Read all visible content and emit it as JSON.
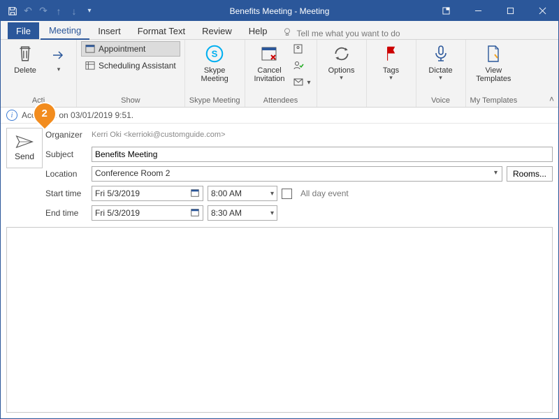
{
  "window": {
    "title": "Benefits Meeting - Meeting"
  },
  "tabs": {
    "file": "File",
    "meeting": "Meeting",
    "insert": "Insert",
    "format_text": "Format Text",
    "review": "Review",
    "help": "Help",
    "tell_me": "Tell me what you want to do"
  },
  "ribbon": {
    "actions": {
      "delete": "Delete",
      "group_label": "Acti"
    },
    "show": {
      "appointment": "Appointment",
      "scheduling_assistant": "Scheduling Assistant",
      "group_label": "Show"
    },
    "skype": {
      "button": "Skype\nMeeting",
      "group_label": "Skype Meeting"
    },
    "attendees": {
      "cancel_invitation": "Cancel\nInvitation",
      "group_label": "Attendees"
    },
    "options": {
      "button": "Options",
      "group_label": ""
    },
    "tags": {
      "button": "Tags",
      "group_label": ""
    },
    "voice": {
      "dictate": "Dictate",
      "group_label": "Voice"
    },
    "templates": {
      "view_templates": "View\nTemplates",
      "group_label": "My Templates"
    }
  },
  "infobar": {
    "text": "Accepted on 03/01/2019 9:51."
  },
  "form": {
    "send": "Send",
    "organizer_label": "Organizer",
    "organizer_value": "Kerri Oki <kerrioki@customguide.com>",
    "subject_label": "Subject",
    "subject_value": "Benefits Meeting",
    "location_label": "Location",
    "location_value": "Conference Room 2",
    "rooms_button": "Rooms...",
    "start_label": "Start time",
    "start_date": "Fri 5/3/2019",
    "start_time": "8:00 AM",
    "end_label": "End time",
    "end_date": "Fri 5/3/2019",
    "end_time": "8:30 AM",
    "all_day_label": "All day event",
    "all_day_checked": false
  },
  "annotation": {
    "number": "2"
  }
}
